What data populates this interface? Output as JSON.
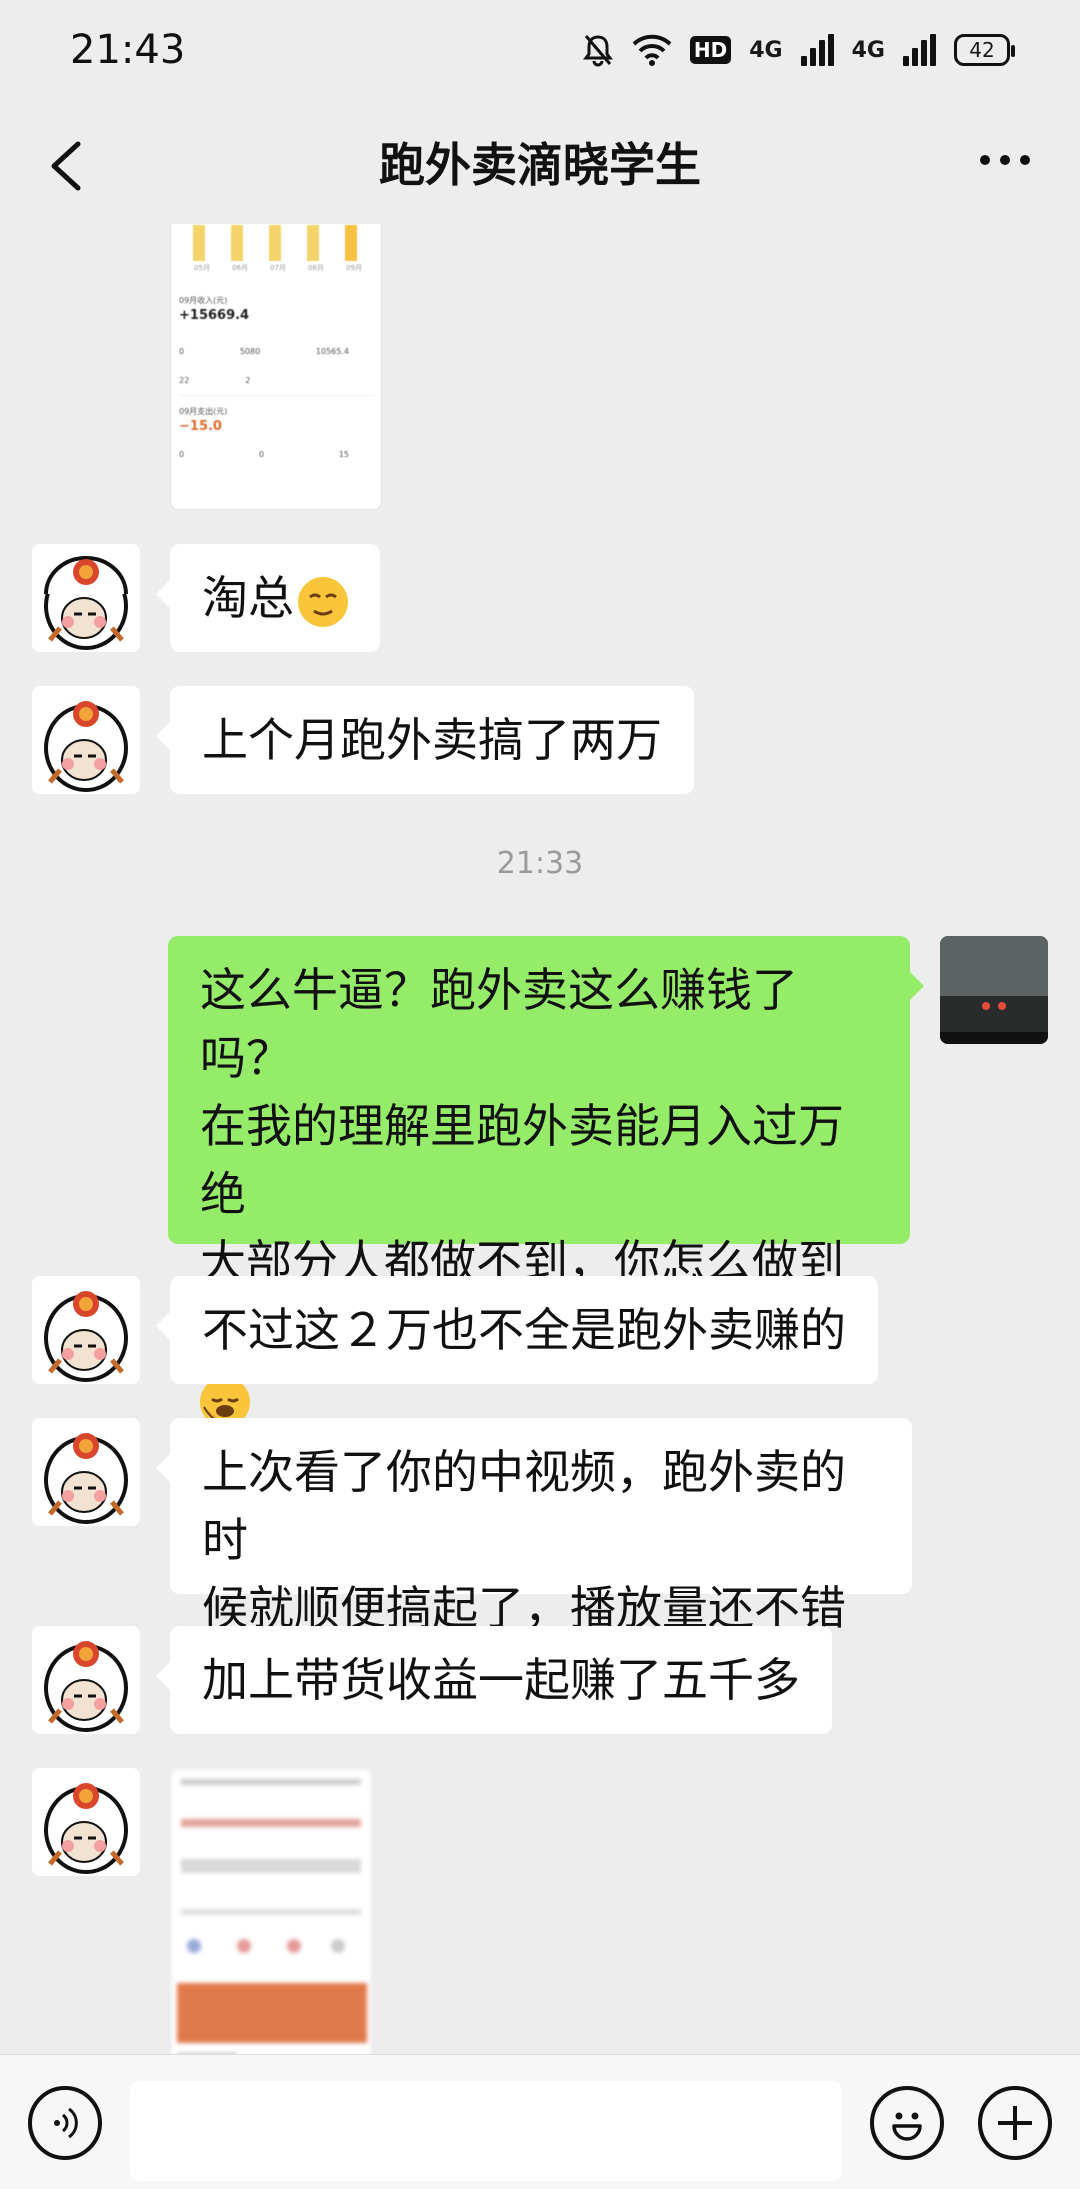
{
  "status": {
    "time": "21:43",
    "hd_label": "HD",
    "net1": "4G",
    "net2": "4G",
    "battery": "42"
  },
  "nav": {
    "title": "跑外卖滴晓学生"
  },
  "screenshot1": {
    "bars": [
      "05月",
      "06月",
      "07月",
      "08月",
      "09月"
    ],
    "income_label": "09月收入(元)",
    "income_value": "+15669.4",
    "r1": [
      "0",
      "5080",
      "10565.4"
    ],
    "r2": [
      "22",
      "2"
    ],
    "expense_label": "09月支出(元)",
    "expense_value": "−15.0",
    "r3": [
      "0",
      "0",
      "15"
    ]
  },
  "messages": {
    "m1": "淘总",
    "m2": "上个月跑外卖搞了两万",
    "ts": "21:33",
    "m3_lines": [
      "这么牛逼？跑外卖这么赚钱了吗？",
      "在我的理解里跑外卖能月入过万绝",
      "大部分人都做不到，你怎么做到的"
    ],
    "m4": "不过这２万也不全是跑外卖赚的",
    "m5_lines": [
      "上次看了你的中视频，跑外卖的时",
      "候就顺便搞起了，播放量还不错"
    ],
    "m6": "加上带货收益一起赚了五千多"
  },
  "colors": {
    "accent": "#95ec69",
    "bg": "#ededed"
  }
}
